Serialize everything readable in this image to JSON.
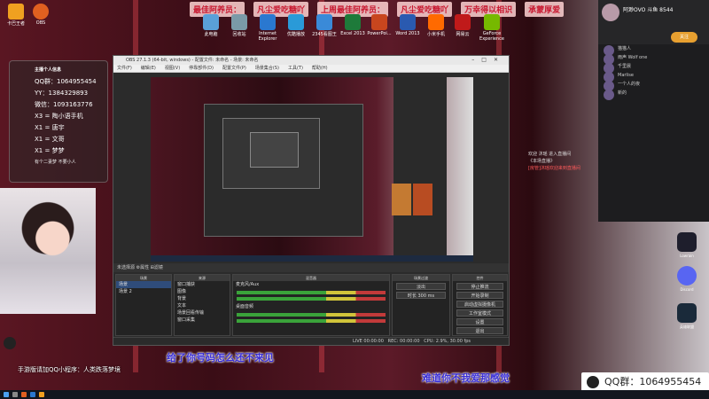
{
  "banner": [
    "最佳阿养员：",
    "凡尘爱吃糖吖",
    "上周最佳阿养员：",
    "凡尘爱吃糖吖",
    "万幸得以相识",
    "承蒙厚爱"
  ],
  "desktop_icons": [
    "卡巴王者",
    "OBS",
    "此电脑",
    "回收站",
    "Internet Explorer",
    "优酷播放",
    "2345看图王",
    "Excel 2013",
    "PowerPoi...",
    "Word 2013",
    "小米手机",
    "网易云",
    "GeForce Experience"
  ],
  "infocard": {
    "title": "主播个人信息",
    "lines": [
      "QQ群：1064955454",
      "YY：1384329893",
      "微信：1093163776",
      "X3 = 陶小语手机",
      "X1 = 唐宇",
      "X1 = 文哥",
      "X1 = 梦梦"
    ],
    "foot": "有个二妻梦 不要小人"
  },
  "obs": {
    "title": "OBS 27.1.3 (64-bit, windows) - 配置文件: 未命名 - 场景: 未命名",
    "menu": [
      "文件(F)",
      "编辑(E)",
      "视图(V)",
      "停靠部件(D)",
      "配置文件(P)",
      "场景集合(S)",
      "工具(T)",
      "帮助(H)"
    ],
    "dock_tabs": "未选择源   ⚙属性   ⊞滤镜",
    "scenes": {
      "title": "场景",
      "items": [
        "场景",
        "场景 2"
      ]
    },
    "sources": {
      "title": "来源",
      "items": [
        "窗口捕获",
        "图像",
        "背景",
        "文本",
        "场景回看传输",
        "窗口采集"
      ]
    },
    "mixer": {
      "title": "混音器",
      "channels": [
        "麦克风/Aux",
        "桌面音频"
      ]
    },
    "transitions": {
      "title": "场景过渡",
      "items": [
        "淡出",
        "时长 300 ms"
      ]
    },
    "controls": {
      "title": "控件",
      "items": [
        "停止推流",
        "开始录制",
        "启动虚拟摄像机",
        "工作室模式",
        "设置",
        "退出"
      ]
    },
    "status": "LIVE 00:00:00   REC: 00:00:00   CPU: 2.9%, 30.00 fps"
  },
  "chat": {
    "streamer": "阿渺OVO 斗鱼 8544",
    "follow": "关注",
    "messages": [
      "猫猫人",
      "雨声 Wolf one",
      "千里晨",
      "Marlise",
      "一个人的夜",
      "新的"
    ],
    "system": [
      "欢迎 沐瑶 进入直播间",
      "《本场直播》",
      "[房管]沐瑶欢迎来到直播间"
    ]
  },
  "right_icons": [
    {
      "name": "Lowrain",
      "color": "#1e1e2c"
    },
    {
      "name": "Discord",
      "color": "#5865f2"
    },
    {
      "name": "英雄联盟",
      "color": "#1a2a3a"
    }
  ],
  "subtitle_1": "给了你号码怎么还不来见",
  "subtitle_2": "难道你不我爱那感觉",
  "qq_tag": "QQ群：1064955454",
  "qq_bottom": "手游版请加QQ小程序：人类跌落梦境"
}
